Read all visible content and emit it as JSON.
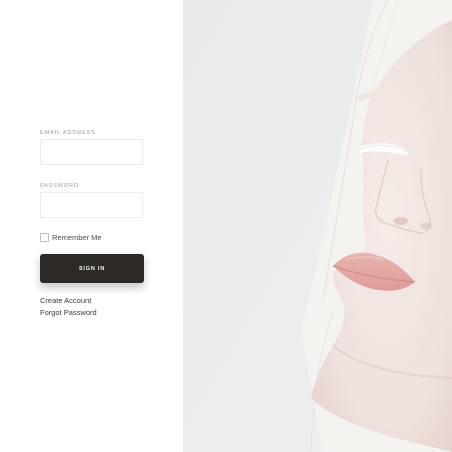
{
  "form": {
    "email_label": "EMAIL ADDRESS",
    "email_value": "",
    "email_placeholder": "",
    "password_label": "PASSWORD",
    "password_value": "",
    "password_placeholder": "",
    "remember_label": "Remember Me",
    "remember_checked": false,
    "signin_label": "SIGN IN"
  },
  "links": {
    "create_account": "Create Account",
    "forgot_password": "Forgot Password"
  },
  "colors": {
    "button_bg": "#2d2924",
    "photo_bg": "#eceded",
    "skin": "#f1e6e3",
    "hair": "#f6f5f1",
    "lips": "#e7aeab"
  }
}
